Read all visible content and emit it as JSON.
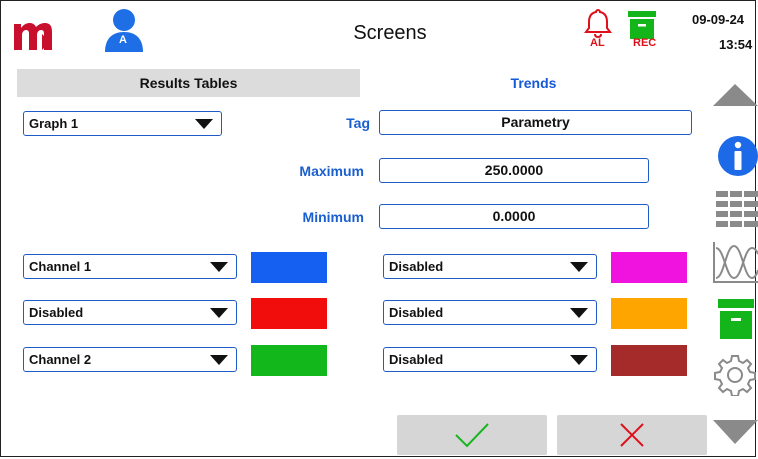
{
  "header": {
    "title": "Screens",
    "alarm_label": "AL",
    "rec_label": "REC",
    "date": "09-09-24",
    "time": "13:54",
    "user_initial": "A"
  },
  "tabs": {
    "results": "Results Tables",
    "trends": "Trends"
  },
  "graph_select": "Graph 1",
  "tag": {
    "label": "Tag",
    "value": "Parametry"
  },
  "maximum": {
    "label": "Maximum",
    "value": "250.0000"
  },
  "minimum": {
    "label": "Minimum",
    "value": "0.0000"
  },
  "channels": {
    "left": [
      {
        "value": "Channel 1",
        "color": "#1560f0"
      },
      {
        "value": "Disabled",
        "color": "#f20d0d"
      },
      {
        "value": "Channel 2",
        "color": "#12b81b"
      }
    ],
    "right": [
      {
        "value": "Disabled",
        "color": "#f012de"
      },
      {
        "value": "Disabled",
        "color": "#ffa500"
      },
      {
        "value": "Disabled",
        "color": "#a52a2a"
      }
    ]
  },
  "colors": {
    "accent_blue": "#1459d8",
    "logo_red": "#c8102e",
    "rec_green": "#13b51b",
    "alarm_red": "#e0101a",
    "sidebar_gray": "#8a8a8a"
  },
  "sidebar_icons": [
    "scroll-up-icon",
    "info-icon",
    "table-icon",
    "trend-graph-icon",
    "archive-icon",
    "settings-icon",
    "scroll-down-icon"
  ]
}
